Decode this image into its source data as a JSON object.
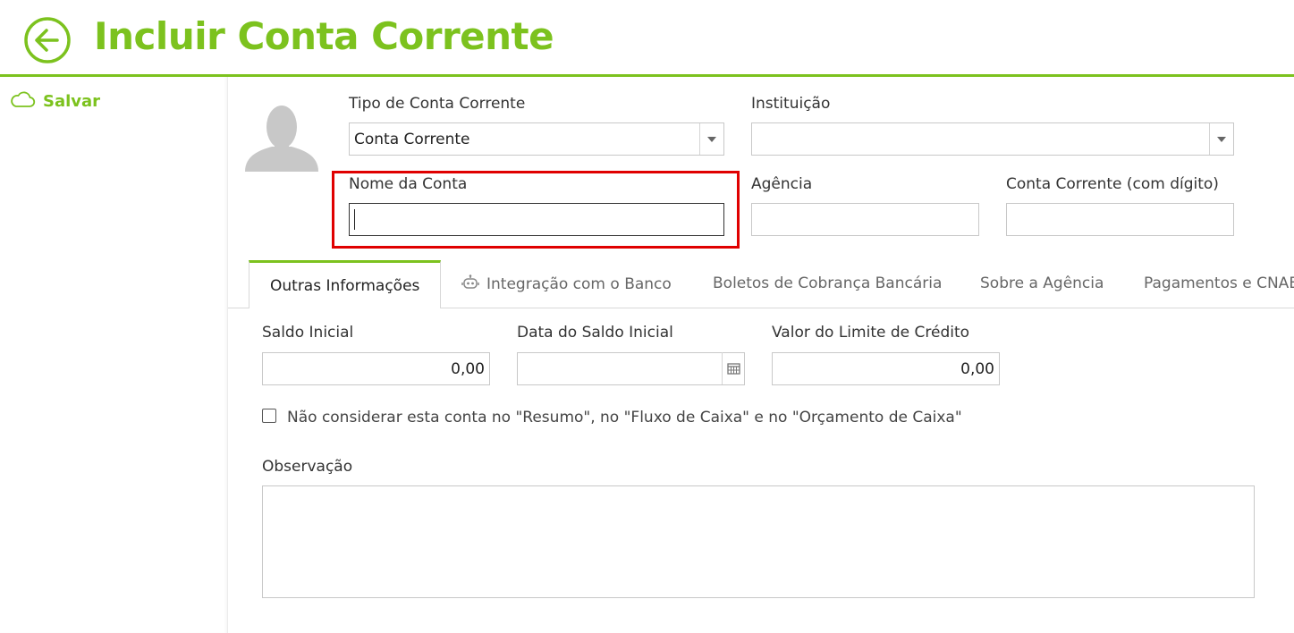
{
  "header": {
    "title": "Incluir Conta Corrente"
  },
  "sidebar": {
    "save_label": "Salvar"
  },
  "form": {
    "tipo_label": "Tipo de Conta Corrente",
    "tipo_value": "Conta Corrente",
    "instituicao_label": "Instituição",
    "instituicao_value": "",
    "nome_label": "Nome da Conta",
    "nome_value": "",
    "agencia_label": "Agência",
    "agencia_value": "",
    "conta_label": "Conta Corrente (com dígito)",
    "conta_value": ""
  },
  "tabs": [
    {
      "label": "Outras Informações"
    },
    {
      "label": "Integração com o Banco"
    },
    {
      "label": "Boletos de Cobrança Bancária"
    },
    {
      "label": "Sobre a Agência"
    },
    {
      "label": "Pagamentos e CNAB"
    }
  ],
  "outras": {
    "saldo_label": "Saldo Inicial",
    "saldo_value": "0,00",
    "data_label": "Data do Saldo Inicial",
    "data_value": "",
    "limite_label": "Valor do Limite de Crédito",
    "limite_value": "0,00",
    "checkbox_label": "Não considerar esta conta no \"Resumo\", no \"Fluxo de Caixa\" e no \"Orçamento de Caixa\"",
    "obs_label": "Observação",
    "obs_value": ""
  },
  "colors": {
    "accent": "#7cc21e",
    "highlight": "#e00000"
  }
}
